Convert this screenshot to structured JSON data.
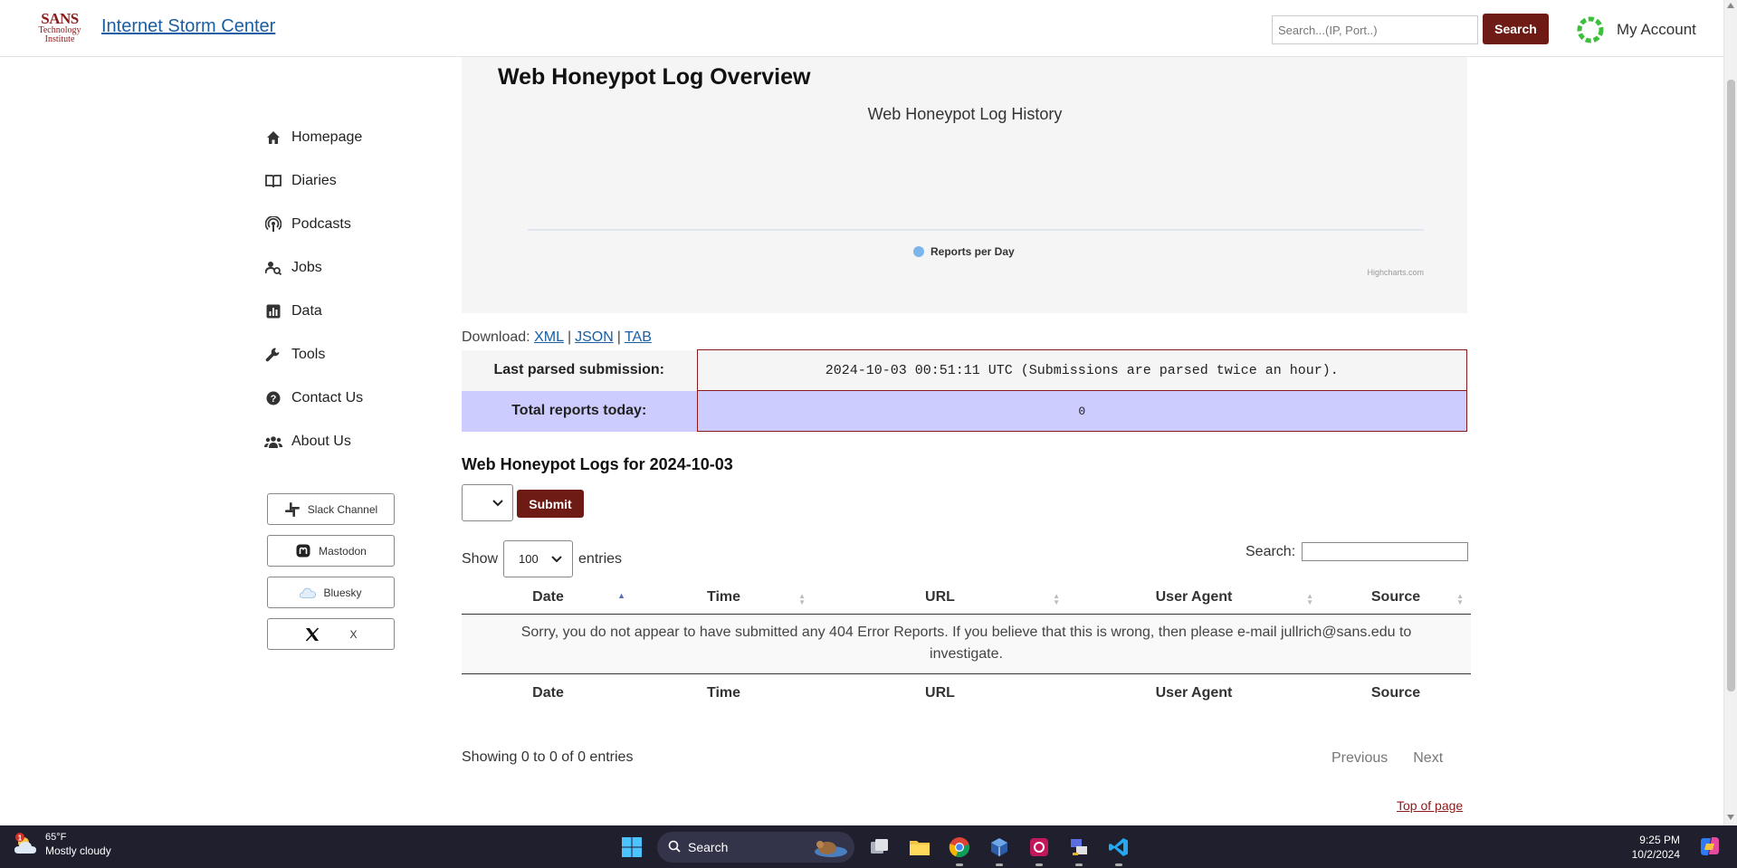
{
  "header": {
    "logo_line1": "SANS",
    "logo_line2": "Technology",
    "logo_line3": "Institute",
    "site_title": "Internet Storm Center",
    "search_placeholder": "Search...(IP, Port..)",
    "search_button": "Search",
    "account_label": "My Account"
  },
  "sidebar": {
    "items": [
      {
        "label": "Homepage",
        "icon": "home-icon"
      },
      {
        "label": "Diaries",
        "icon": "book-icon"
      },
      {
        "label": "Podcasts",
        "icon": "podcast-icon"
      },
      {
        "label": "Jobs",
        "icon": "jobs-icon"
      },
      {
        "label": "Data",
        "icon": "chart-icon"
      },
      {
        "label": "Tools",
        "icon": "wrench-icon"
      },
      {
        "label": "Contact Us",
        "icon": "question-icon"
      },
      {
        "label": "About Us",
        "icon": "people-icon"
      }
    ],
    "social": [
      {
        "label": "Slack Channel",
        "icon": "slack-icon"
      },
      {
        "label": "Mastodon",
        "icon": "mastodon-icon"
      },
      {
        "label": "Bluesky",
        "icon": "bluesky-icon"
      },
      {
        "label": "X",
        "icon": "x-icon"
      }
    ]
  },
  "main": {
    "title": "Web Honeypot Log Overview",
    "download_label": "Download:",
    "download_links": [
      "XML",
      "JSON",
      "TAB"
    ],
    "last_parsed_label": "Last parsed submission:",
    "last_parsed_value": "2024-10-03 00:51:11 UTC (Submissions are parsed twice an hour).",
    "total_reports_label": "Total reports today:",
    "total_reports_value": "0",
    "logs_heading": "Web Honeypot Logs for 2024-10-03",
    "submit_button": "Submit",
    "show_label": "Show",
    "entries_value": "100",
    "entries_label": "entries",
    "search_label": "Search:",
    "columns": [
      "Date",
      "Time",
      "URL",
      "User Agent",
      "Source"
    ],
    "empty_message": "Sorry, you do not appear to have submitted any 404 Error Reports. If you believe that this is wrong, then please e-mail jullrich@sans.edu to investigate.",
    "info_text": "Showing 0 to 0 of 0 entries",
    "pager_previous": "Previous",
    "pager_next": "Next",
    "top_link": "Top of page"
  },
  "chart_data": {
    "type": "line",
    "title": "Web Honeypot Log History",
    "series": [
      {
        "name": "Reports per Day",
        "values": []
      }
    ],
    "credits": "Highcharts.com",
    "legend_position": "bottom-center",
    "series_color": "#7cb5ec"
  },
  "taskbar": {
    "weather_temp": "65°F",
    "weather_desc": "Mostly cloudy",
    "weather_badge": "1",
    "search_label": "Search",
    "time": "9:25 PM",
    "date": "10/2/2024"
  },
  "colors": {
    "brand_red": "#6e1b15",
    "link_blue": "#1a5fa3",
    "highlight_row": "#ccccff"
  }
}
